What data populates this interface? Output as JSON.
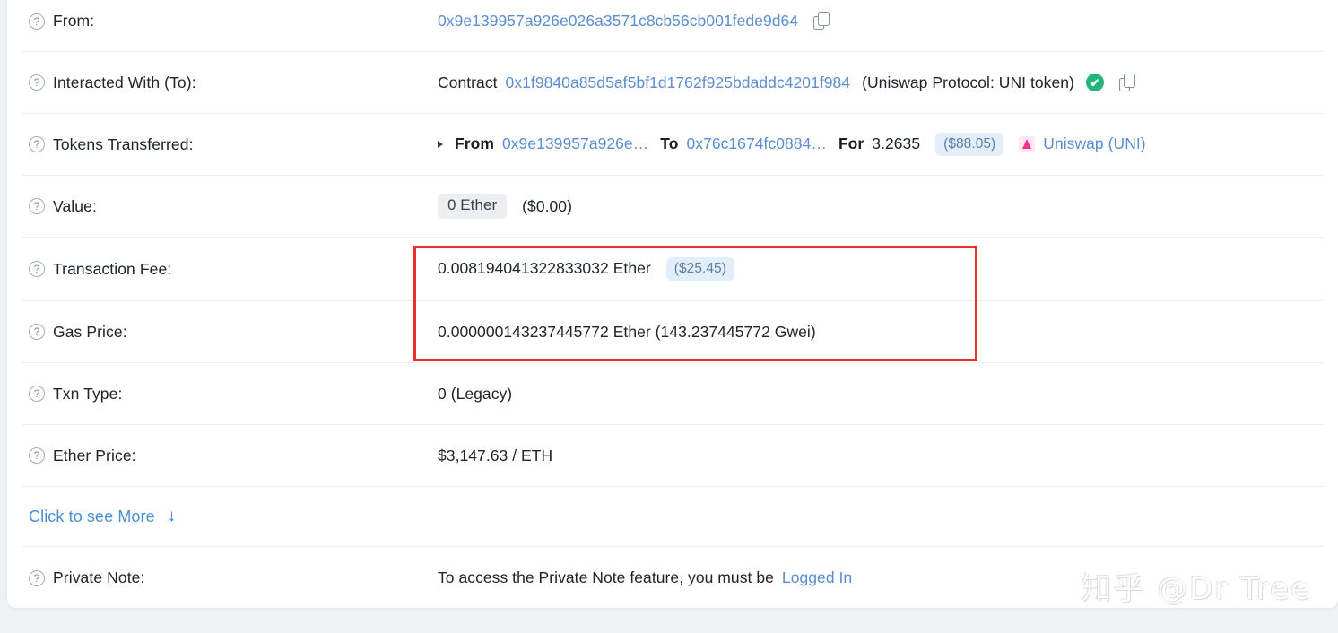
{
  "rows": {
    "from": {
      "label": "From:",
      "address": "0x9e139957a926e026a3571c8cb56cb001fede9d64",
      "copy_icon": "copy-icon",
      "help_icon": "question-circle-icon",
      "help_glyph": "?"
    },
    "interacted_with": {
      "label": "Interacted With (To):",
      "prefix": "Contract",
      "address": "0x1f9840a85d5af5bf1d1762f925bdaddc4201f984",
      "annotation": "(Uniswap Protocol: UNI token)",
      "verified_icon": "verified-check-icon",
      "verified_glyph": "✔",
      "copy_icon": "copy-icon"
    },
    "tokens_transferred": {
      "label": "Tokens Transferred:",
      "from_label": "From",
      "from_address": "0x9e139957a926e…",
      "to_label": "To",
      "to_address": "0x76c1674fc0884…",
      "for_label": "For",
      "amount": "3.2635",
      "usd_badge": "($88.05)",
      "token_name": "Uniswap (UNI)",
      "token_icon": "uniswap-token-icon"
    },
    "value": {
      "label": "Value:",
      "amount_pill": "0 Ether",
      "usd": "($0.00)"
    },
    "transaction_fee": {
      "label": "Transaction Fee:",
      "amount": "0.008194041322833032 Ether",
      "usd_badge": "($25.45)"
    },
    "gas_price": {
      "label": "Gas Price:",
      "value": "0.000000143237445772 Ether (143.237445772 Gwei)"
    },
    "txn_type": {
      "label": "Txn Type:",
      "value": "0 (Legacy)"
    },
    "ether_price": {
      "label": "Ether Price:",
      "value": "$3,147.63 / ETH"
    },
    "click_more": {
      "label": "Click to see More",
      "arrow_glyph": "↓",
      "arrow_icon": "arrow-down-icon"
    },
    "private_note": {
      "label": "Private Note:",
      "text": "To access the Private Note feature, you must be",
      "link": "Logged In"
    }
  },
  "watermark": {
    "text": "知乎 @Dr Tree"
  },
  "colors": {
    "link": "#5b8dd2",
    "verified_green": "#24b47e",
    "highlight_red": "#e8312a",
    "badge_blue_bg": "#e3eefb",
    "pill_gray_bg": "#eceef1",
    "text": "#21242a"
  }
}
